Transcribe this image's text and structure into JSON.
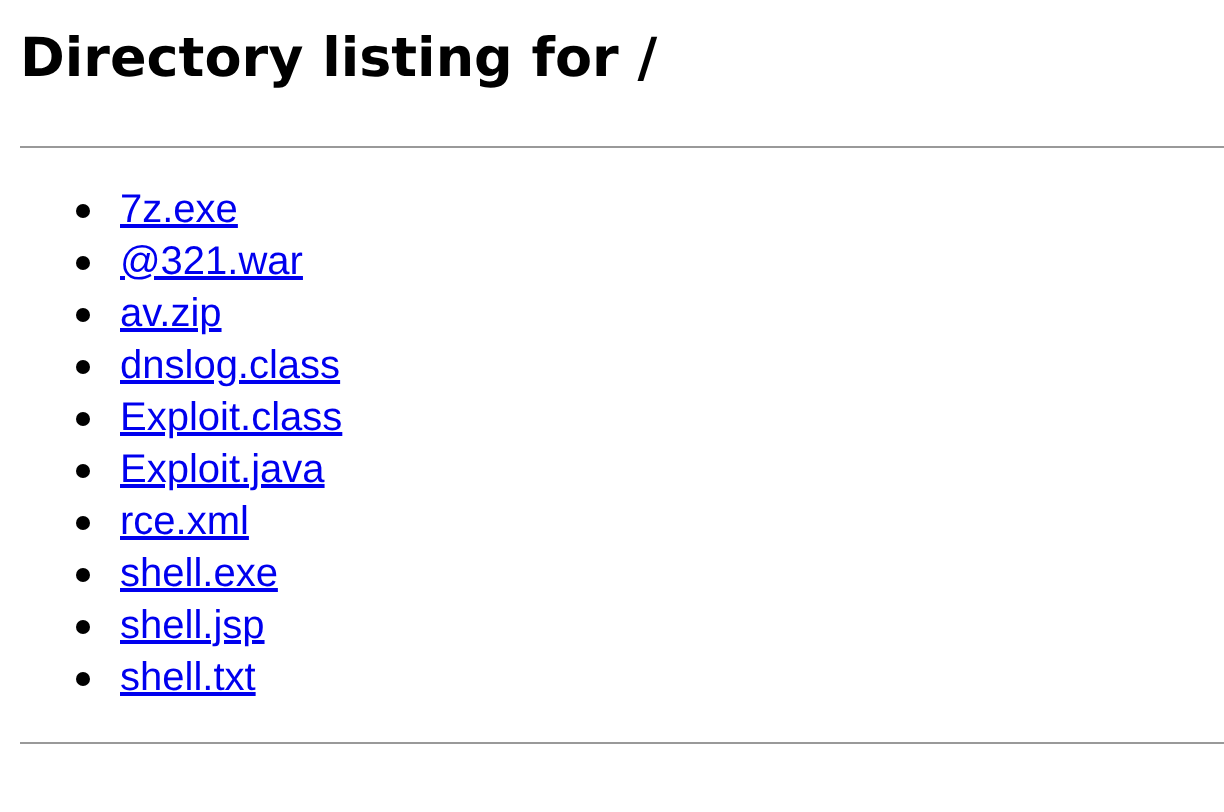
{
  "heading": "Directory listing for /",
  "files": [
    {
      "name": "7z.exe"
    },
    {
      "name": "@321.war"
    },
    {
      "name": "av.zip"
    },
    {
      "name": "dnslog.class"
    },
    {
      "name": "Exploit.class"
    },
    {
      "name": "Exploit.java"
    },
    {
      "name": "rce.xml"
    },
    {
      "name": "shell.exe"
    },
    {
      "name": "shell.jsp"
    },
    {
      "name": "shell.txt"
    }
  ]
}
